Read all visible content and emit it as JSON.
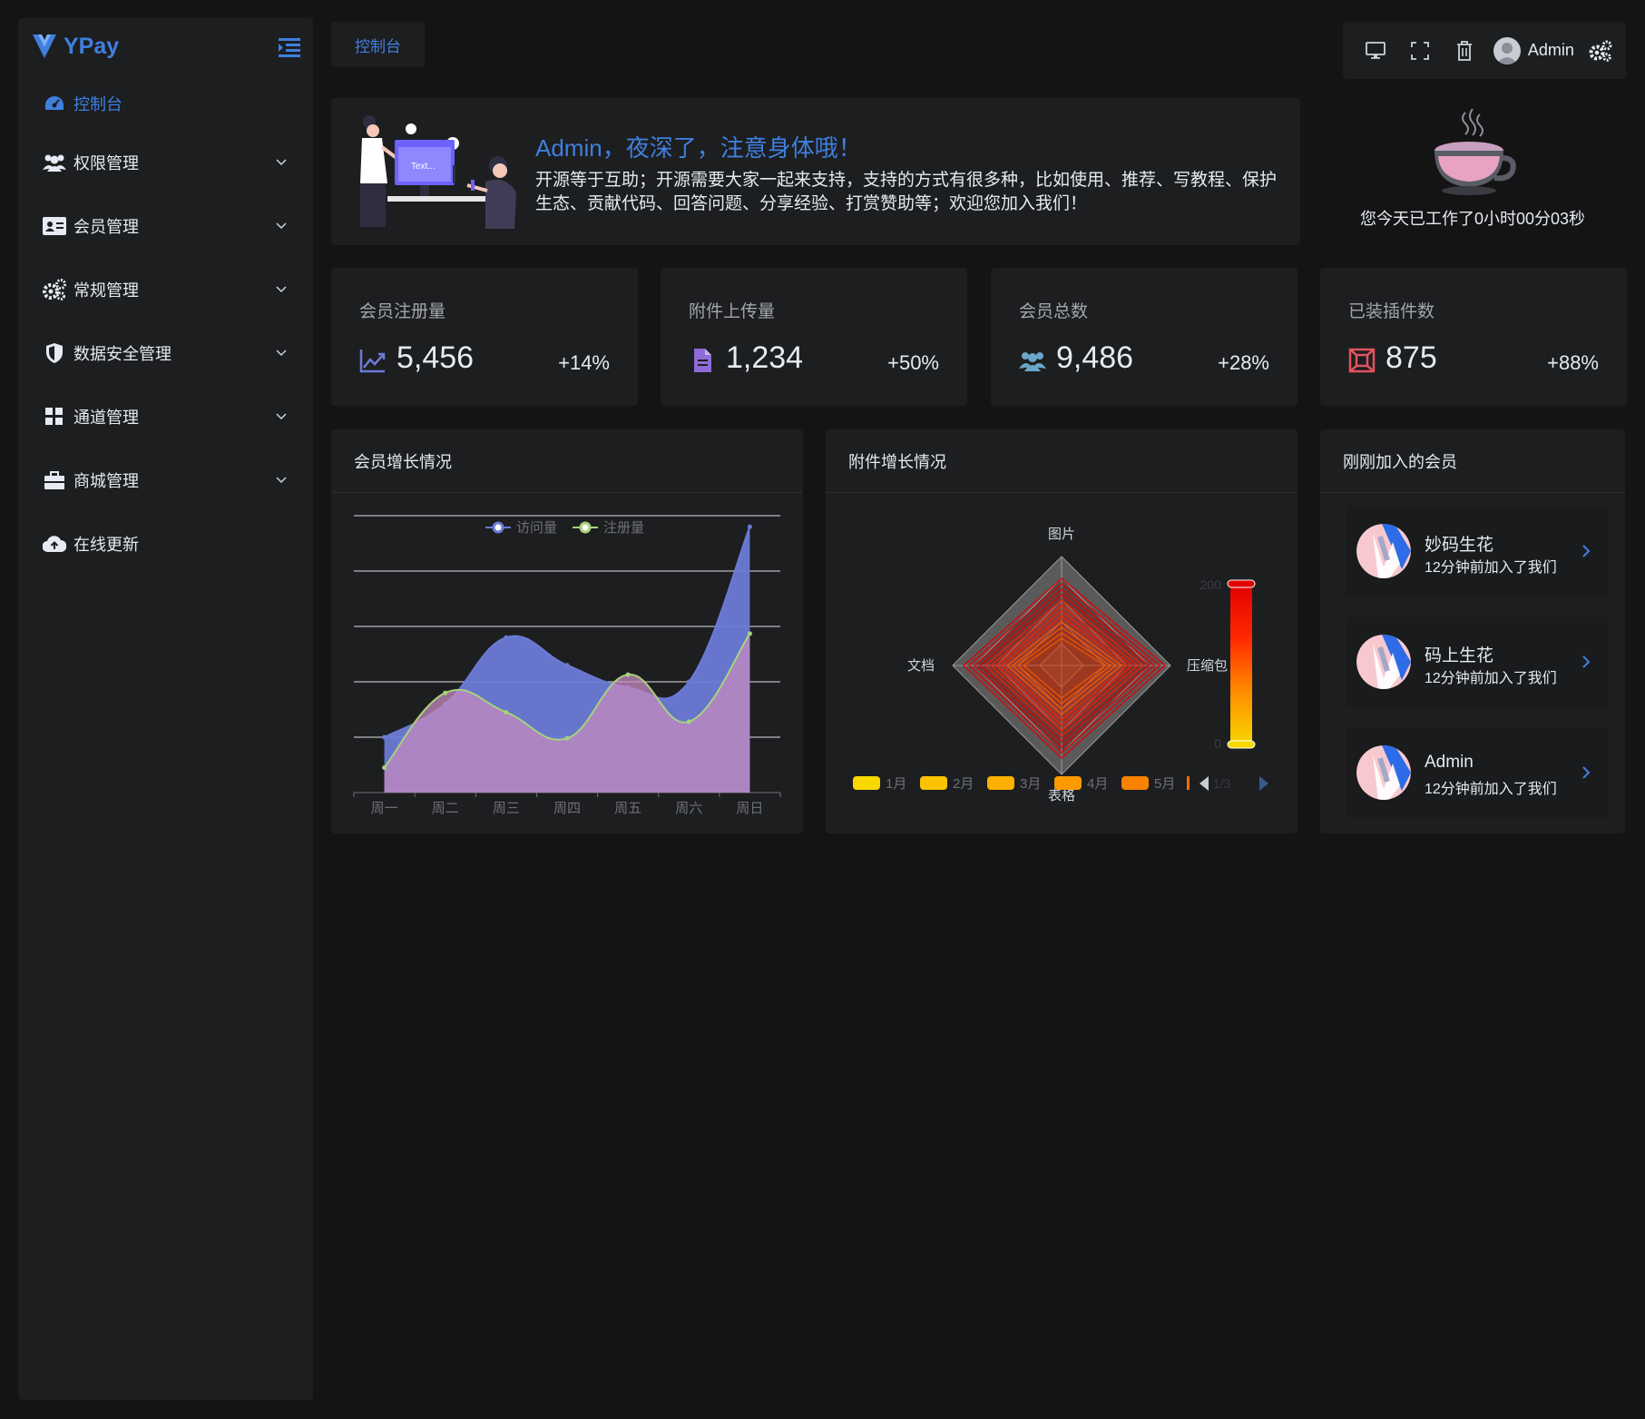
{
  "app": {
    "name": "YPay"
  },
  "colors": {
    "accent": "#3f7fe0",
    "background": "#141414",
    "panel": "#1d1e1f"
  },
  "sidebar": {
    "items": [
      {
        "label": "控制台",
        "icon": "dashboard-icon",
        "active": true
      },
      {
        "label": "权限管理",
        "icon": "users-icon"
      },
      {
        "label": "会员管理",
        "icon": "id-card-icon"
      },
      {
        "label": "常规管理",
        "icon": "gears-icon"
      },
      {
        "label": "数据安全管理",
        "icon": "shield-icon"
      },
      {
        "label": "通道管理",
        "icon": "grid-icon"
      },
      {
        "label": "商城管理",
        "icon": "briefcase-icon"
      },
      {
        "label": "在线更新",
        "icon": "cloud-upload-icon"
      }
    ]
  },
  "topbar": {
    "tab": "控制台",
    "user": "Admin",
    "tools": [
      "desktop-icon",
      "fullscreen-icon",
      "trash-icon",
      "user-avatar-icon",
      "settings-icon"
    ]
  },
  "welcome": {
    "title": "Admin，夜深了，注意身体哦！",
    "text": "开源等于互助；开源需要大家一起来支持，支持的方式有很多种，比如使用、推荐、写教程、保护生态、贡献代码、回答问题、分享经验、打赏赞助等；欢迎您加入我们！",
    "illustration_text": "Text..."
  },
  "worktime": {
    "text": "您今天已工作了0小时00分03秒"
  },
  "stats": [
    {
      "title": "会员注册量",
      "value": "5,456",
      "change": "+14%",
      "icon": "line-chart-icon",
      "color": "#6b7bd6"
    },
    {
      "title": "附件上传量",
      "value": "1,234",
      "change": "+50%",
      "icon": "file-icon",
      "color": "#8e6bd6"
    },
    {
      "title": "会员总数",
      "value": "9,486",
      "change": "+28%",
      "icon": "users-icon",
      "color": "#6aa7c9"
    },
    {
      "title": "已装插件数",
      "value": "875",
      "change": "+88%",
      "icon": "plugin-icon",
      "color": "#e0535f"
    }
  ],
  "cards": {
    "growth": "会员增长情况",
    "attach": "附件增长情况",
    "members": "刚刚加入的会员"
  },
  "chart_data": [
    {
      "type": "area",
      "categories": [
        "周一",
        "周二",
        "周三",
        "周四",
        "周五",
        "周六",
        "周日"
      ],
      "series": [
        {
          "name": "访问量",
          "values": [
            100,
            160,
            280,
            230,
            190,
            200,
            480
          ],
          "color": "#6b7bd6"
        },
        {
          "name": "注册量",
          "values": [
            45,
            180,
            145,
            98,
            213,
            128,
            287
          ],
          "color": "#a7d27c"
        }
      ],
      "ylim": [
        0,
        500
      ],
      "grid": true,
      "legend": "top"
    },
    {
      "type": "radar",
      "indicators": [
        "图片",
        "压缩包",
        "表格",
        "文档"
      ],
      "visualmap": {
        "max": "200",
        "min": "0",
        "colors": [
          "#f8d800",
          "#ff8c00",
          "#ff2800",
          "#e00000"
        ]
      },
      "legend": [
        "1月",
        "2月",
        "3月",
        "4月",
        "5月"
      ],
      "legend_colors": [
        "#f8d800",
        "#fbc300",
        "#fcb000",
        "#fb9a00",
        "#f98200"
      ],
      "legend_page": "1/3",
      "series_peaks": [
        [
          50,
          80,
          60,
          70
        ],
        [
          60,
          90,
          70,
          80
        ],
        [
          70,
          100,
          80,
          90
        ],
        [
          80,
          110,
          90,
          100
        ],
        [
          90,
          120,
          100,
          110
        ],
        [
          100,
          130,
          110,
          120
        ],
        [
          110,
          140,
          120,
          130
        ],
        [
          120,
          150,
          130,
          140
        ],
        [
          130,
          160,
          140,
          150
        ],
        [
          140,
          170,
          150,
          160
        ],
        [
          150,
          180,
          160,
          170
        ],
        [
          160,
          190,
          170,
          180
        ]
      ]
    }
  ],
  "members": [
    {
      "name": "妙码生花",
      "time": "12分钟前加入了我们"
    },
    {
      "name": "码上生花",
      "time": "12分钟前加入了我们"
    },
    {
      "name": "Admin",
      "time": "12分钟前加入了我们"
    }
  ]
}
